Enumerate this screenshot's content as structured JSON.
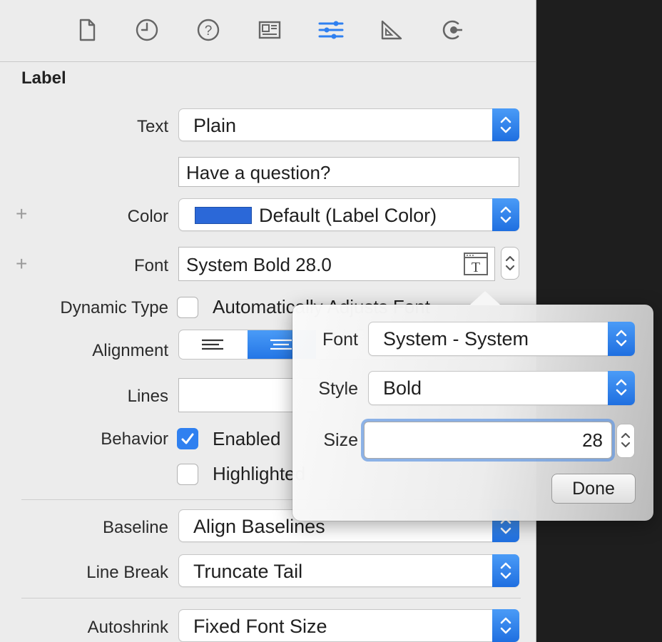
{
  "toolbar": {
    "icons": [
      "file-icon",
      "clock-icon",
      "help-icon",
      "identity-card-icon",
      "attributes-sliders-icon",
      "size-ruler-icon",
      "connections-icon"
    ],
    "active_color": "#2f80f0"
  },
  "section": {
    "title": "Label"
  },
  "rows": {
    "text": {
      "label": "Text",
      "value": "Plain"
    },
    "text_content": {
      "value": "Have a question?"
    },
    "color": {
      "label": "Color",
      "value": "Default (Label Color)",
      "swatch": "#2b68d8"
    },
    "font": {
      "label": "Font",
      "value": "System Bold 28.0"
    },
    "dynamic_type": {
      "label": "Dynamic Type",
      "checkbox_label": "Automatically Adjusts Font"
    },
    "alignment": {
      "label": "Alignment"
    },
    "lines": {
      "label": "Lines"
    },
    "behavior": {
      "label": "Behavior",
      "enabled_label": "Enabled",
      "highlighted_label": "Highlighted"
    },
    "baseline": {
      "label": "Baseline",
      "value": "Align Baselines"
    },
    "line_break": {
      "label": "Line Break",
      "value": "Truncate Tail"
    },
    "autoshrink": {
      "label": "Autoshrink",
      "value": "Fixed Font Size"
    }
  },
  "plus_symbol": "+",
  "popover": {
    "font_label": "Font",
    "font_value": "System - System",
    "style_label": "Style",
    "style_value": "Bold",
    "size_label": "Size",
    "size_value": "28",
    "done_label": "Done"
  },
  "colors": {
    "accent": "#2f80f0"
  }
}
